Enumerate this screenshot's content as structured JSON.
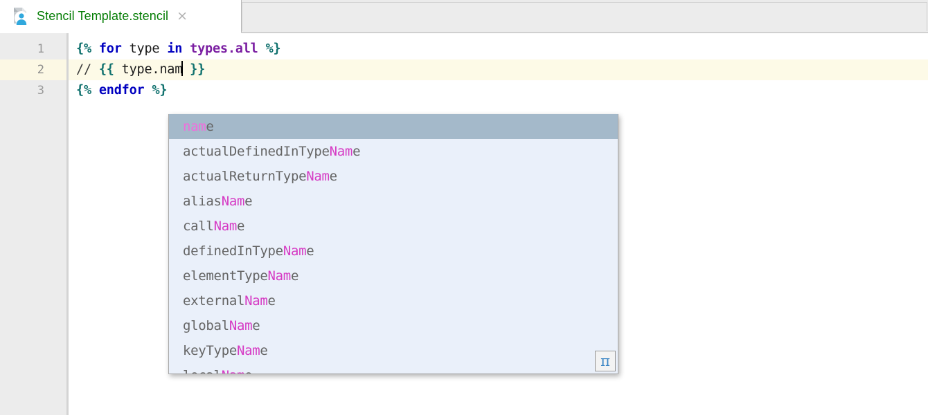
{
  "tab": {
    "title": "Stencil Template.stencil",
    "icon": "stencil-file-icon",
    "close_label": "×",
    "title_color": "#047d04"
  },
  "editor": {
    "gutter_line_numbers": [
      "1",
      "2",
      "3"
    ],
    "current_line": 2,
    "lines": [
      {
        "number": "1",
        "tokens": [
          {
            "text": "{%",
            "type": "tag"
          },
          {
            "text": " ",
            "type": "plain"
          },
          {
            "text": "for",
            "type": "kw"
          },
          {
            "text": " type ",
            "type": "plain"
          },
          {
            "text": "in",
            "type": "kw"
          },
          {
            "text": " ",
            "type": "plain"
          },
          {
            "text": "types.all",
            "type": "var"
          },
          {
            "text": " ",
            "type": "plain"
          },
          {
            "text": "%}",
            "type": "tag"
          }
        ]
      },
      {
        "number": "2",
        "tokens": [
          {
            "text": "// ",
            "type": "comment"
          },
          {
            "text": "{{",
            "type": "tag"
          },
          {
            "text": " type.nam",
            "type": "plain"
          },
          {
            "text": "CARET",
            "type": "caret"
          },
          {
            "text": " ",
            "type": "plain"
          },
          {
            "text": "}}",
            "type": "tag"
          }
        ]
      },
      {
        "number": "3",
        "tokens": [
          {
            "text": "{%",
            "type": "tag"
          },
          {
            "text": " ",
            "type": "plain"
          },
          {
            "text": "endfor",
            "type": "kw"
          },
          {
            "text": " ",
            "type": "plain"
          },
          {
            "text": "%}",
            "type": "tag"
          }
        ]
      }
    ]
  },
  "completion_popup": {
    "selected_index": 0,
    "match_text": "Nam",
    "items": [
      {
        "prefix": "",
        "match": "nam",
        "suffix": "e",
        "selected": true
      },
      {
        "prefix": "actualDefinedInType",
        "match": "Nam",
        "suffix": "e",
        "selected": false
      },
      {
        "prefix": "actualReturnType",
        "match": "Nam",
        "suffix": "e",
        "selected": false
      },
      {
        "prefix": "alias",
        "match": "Nam",
        "suffix": "e",
        "selected": false
      },
      {
        "prefix": "call",
        "match": "Nam",
        "suffix": "e",
        "selected": false
      },
      {
        "prefix": "definedInType",
        "match": "Nam",
        "suffix": "e",
        "selected": false
      },
      {
        "prefix": "elementType",
        "match": "Nam",
        "suffix": "e",
        "selected": false
      },
      {
        "prefix": "external",
        "match": "Nam",
        "suffix": "e",
        "selected": false
      },
      {
        "prefix": "global",
        "match": "Nam",
        "suffix": "e",
        "selected": false
      },
      {
        "prefix": "keyType",
        "match": "Nam",
        "suffix": "e",
        "selected": false
      },
      {
        "prefix": "local",
        "match": "Nam",
        "suffix": "e",
        "selected": false
      }
    ],
    "badge_label": "π",
    "selected_bg": "#a4b9ca",
    "background": "#eaf0fa",
    "match_color": "#d63bc4"
  }
}
